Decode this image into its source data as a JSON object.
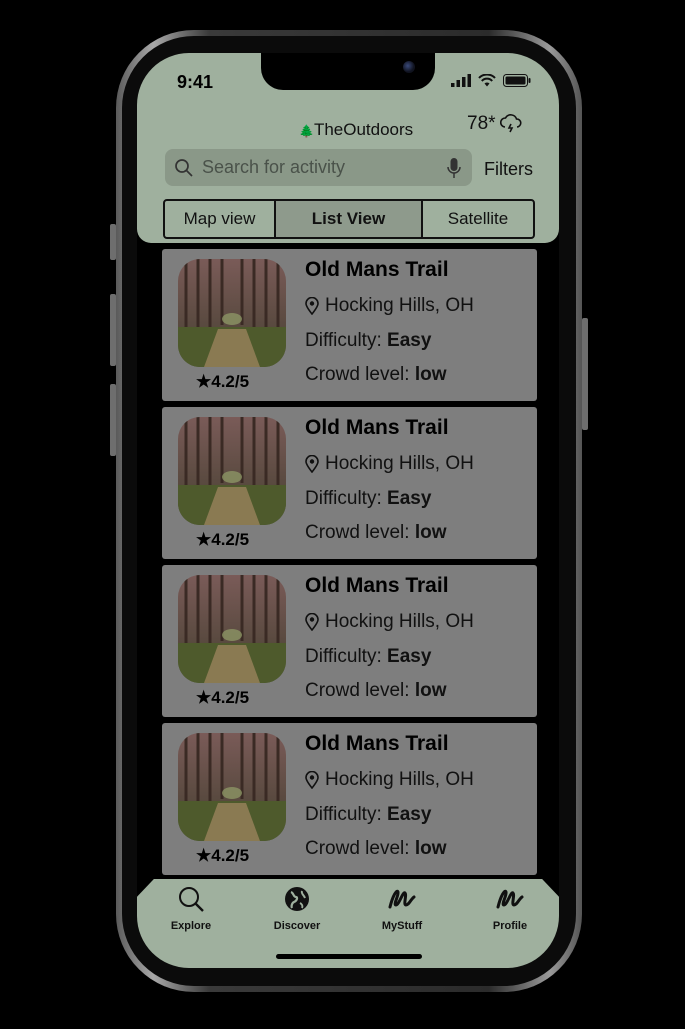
{
  "status_bar": {
    "time": "9:41"
  },
  "header": {
    "brand": "TheOutdoors",
    "weather_temp": "78*",
    "search_placeholder": "Search for activity",
    "filters_label": "Filters"
  },
  "view_toggle": [
    "Map view",
    "List View",
    "Satellite"
  ],
  "trails": [
    {
      "name": "Old Mans Trail",
      "location": "Hocking Hills, OH",
      "difficulty_label": "Difficulty:",
      "difficulty": "Easy",
      "crowd_label": "Crowd level:",
      "crowd": "low",
      "rating": "4.2/5"
    },
    {
      "name": "Old Mans Trail",
      "location": "Hocking Hills, OH",
      "difficulty_label": "Difficulty:",
      "difficulty": "Easy",
      "crowd_label": "Crowd level:",
      "crowd": "low",
      "rating": "4.2/5"
    },
    {
      "name": "Old Mans Trail",
      "location": "Hocking Hills, OH",
      "difficulty_label": "Difficulty:",
      "difficulty": "Easy",
      "crowd_label": "Crowd level:",
      "crowd": "low",
      "rating": "4.2/5"
    },
    {
      "name": "Old Mans Trail",
      "location": "Hocking Hills, OH",
      "difficulty_label": "Difficulty:",
      "difficulty": "Easy",
      "crowd_label": "Crowd level:",
      "crowd": "low",
      "rating": "4.2/5"
    }
  ],
  "tabbar": {
    "explore": "Explore",
    "discover": "Discover",
    "mystuff": "MyStuff",
    "profile": "Profile"
  },
  "colors": {
    "header_bg": "#9fb09e",
    "card_bg": "#7e7e7e"
  },
  "icons": [
    "tree-icon",
    "cloud-storm-icon",
    "search-icon",
    "mic-icon",
    "location-pin-icon",
    "star-icon",
    "globe-icon",
    "scribble-icon"
  ]
}
